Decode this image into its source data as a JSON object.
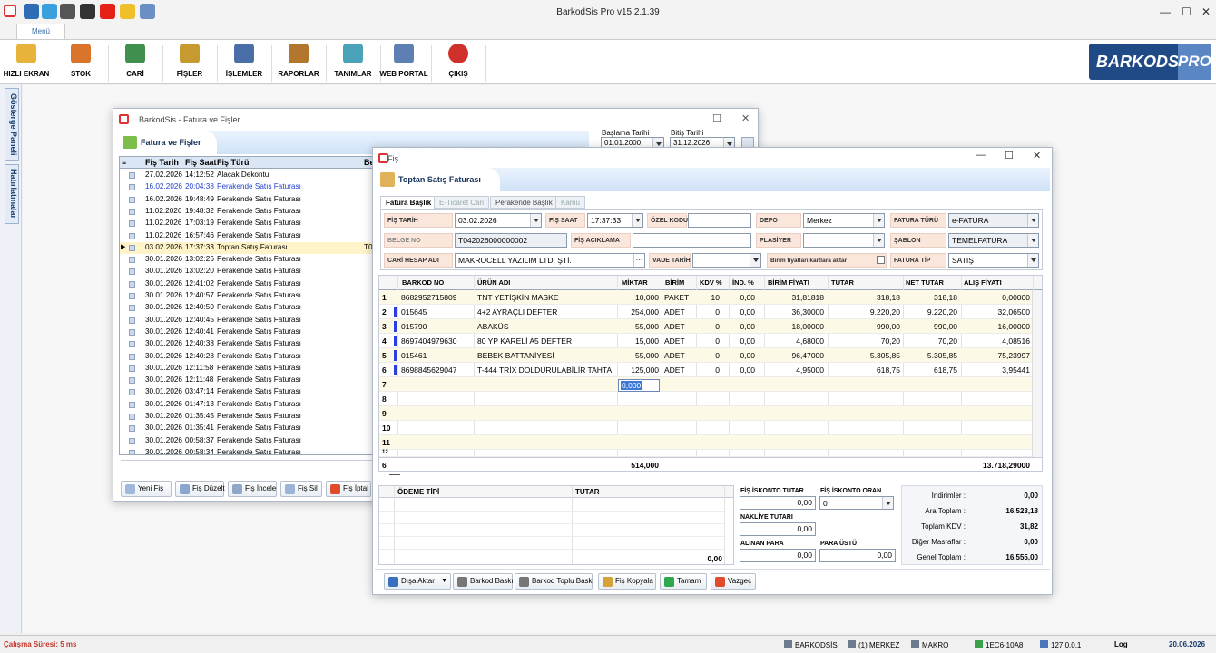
{
  "app": {
    "title": "BarkodSis Pro v15.2.1.39"
  },
  "ribbon": {
    "menu_tab": "Menü",
    "buttons": [
      {
        "label": "HIZLI EKRAN",
        "color": "#e8b33a"
      },
      {
        "label": "STOK",
        "color": "#d9742a"
      },
      {
        "label": "CARİ",
        "color": "#3f8f4f"
      },
      {
        "label": "FİŞLER",
        "color": "#c79a30"
      },
      {
        "label": "İŞLEMLER",
        "color": "#4a6ea8"
      },
      {
        "label": "RAPORLAR",
        "color": "#b2762f"
      },
      {
        "label": "TANIMLAR",
        "color": "#4aa3b8"
      },
      {
        "label": "WEB PORTAL",
        "color": "#5d7fb3"
      },
      {
        "label": "ÇIKIŞ",
        "color": "#d0302a"
      }
    ],
    "logo": "BARKODSİS",
    "logo_pro": "PRO"
  },
  "side": {
    "tab1": "Gösterge Paneli",
    "tab2": "Hatırlatmalar"
  },
  "listwin": {
    "title": "BarkodSis - Fatura ve Fişler",
    "header": "Fatura ve Fişler",
    "start_label": "Başlama Tarihi",
    "start_value": "01.01.2000",
    "end_label": "Bitiş Tarihi",
    "end_value": "31.12.2026",
    "columns": [
      "Fiş Tarih",
      "Fiş Saat",
      "Fiş Türü",
      "Be"
    ],
    "rows": [
      {
        "date": "27.02.2026",
        "time": "14:12:52",
        "type": "Alacak Dekontu",
        "style": "normal"
      },
      {
        "date": "16.02.2026",
        "time": "20:04:38",
        "type": "Perakende Satış Faturası",
        "style": "blue"
      },
      {
        "date": "16.02.2026",
        "time": "19:48:49",
        "type": "Perakende Satış Faturası",
        "style": "normal"
      },
      {
        "date": "11.02.2026",
        "time": "19:48:32",
        "type": "Perakende Satış Faturası",
        "style": "normal"
      },
      {
        "date": "11.02.2026",
        "time": "17:03:19",
        "type": "Perakende Satış Faturası",
        "style": "normal"
      },
      {
        "date": "11.02.2026",
        "time": "16:57:46",
        "type": "Perakende Satış Faturası",
        "style": "normal"
      },
      {
        "date": "03.02.2026",
        "time": "17:37:33",
        "type": "Toptan Satış Faturası",
        "style": "selected",
        "extra": "T04"
      },
      {
        "date": "30.01.2026",
        "time": "13:02:26",
        "type": "Perakende Satış Faturası",
        "style": "normal"
      },
      {
        "date": "30.01.2026",
        "time": "13:02:20",
        "type": "Perakende Satış Faturası",
        "style": "normal"
      },
      {
        "date": "30.01.2026",
        "time": "12:41:02",
        "type": "Perakende Satış Faturası",
        "style": "normal"
      },
      {
        "date": "30.01.2026",
        "time": "12:40:57",
        "type": "Perakende Satış Faturası",
        "style": "normal"
      },
      {
        "date": "30.01.2026",
        "time": "12:40:50",
        "type": "Perakende Satış Faturası",
        "style": "normal"
      },
      {
        "date": "30.01.2026",
        "time": "12:40:45",
        "type": "Perakende Satış Faturası",
        "style": "normal"
      },
      {
        "date": "30.01.2026",
        "time": "12:40:41",
        "type": "Perakende Satış Faturası",
        "style": "normal"
      },
      {
        "date": "30.01.2026",
        "time": "12:40:38",
        "type": "Perakende Satış Faturası",
        "style": "normal"
      },
      {
        "date": "30.01.2026",
        "time": "12:40:28",
        "type": "Perakende Satış Faturası",
        "style": "normal"
      },
      {
        "date": "30.01.2026",
        "time": "12:11:58",
        "type": "Perakende Satış Faturası",
        "style": "normal"
      },
      {
        "date": "30.01.2026",
        "time": "12:11:48",
        "type": "Perakende Satış Faturası",
        "style": "normal"
      },
      {
        "date": "30.01.2026",
        "time": "03:47:14",
        "type": "Perakende Satış Faturası",
        "style": "normal"
      },
      {
        "date": "30.01.2026",
        "time": "01:47:13",
        "type": "Perakende Satış Faturası",
        "style": "normal"
      },
      {
        "date": "30.01.2026",
        "time": "01:35:45",
        "type": "Perakende Satış Faturası",
        "style": "normal"
      },
      {
        "date": "30.01.2026",
        "time": "01:35:41",
        "type": "Perakende Satış Faturası",
        "style": "normal"
      },
      {
        "date": "30.01.2026",
        "time": "00:58:37",
        "type": "Perakende Satış Faturası",
        "style": "normal"
      },
      {
        "date": "30.01.2026",
        "time": "00:58:34",
        "type": "Perakende Satış Faturası",
        "style": "normal"
      }
    ],
    "buttons": [
      "Yeni Fiş",
      "Fiş Düzelt",
      "Fiş İncele",
      "Fiş Sil",
      "Fiş İptal"
    ]
  },
  "fis": {
    "title": "Fiş",
    "header": "Toptan Satış Faturası",
    "tabs": [
      "Fatura Başlık",
      "E-Ticaret Cari",
      "Perakende Başlık",
      "Kamu"
    ],
    "fields": {
      "fis_tarih_label": "FİŞ TARİH",
      "fis_tarih": "03.02.2026",
      "fis_saat_label": "FİŞ SAAT",
      "fis_saat": "17:37:33",
      "ozel_kodu_label": "ÖZEL KODU",
      "ozel_kodu": "",
      "depo_label": "DEPO",
      "depo": "Merkez",
      "fatura_turu_label": "FATURA TÜRÜ",
      "fatura_turu": "e-FATURA",
      "belge_no_label": "BELGE NO",
      "belge_no": "T042026000000002",
      "fis_aciklama_label": "FİŞ AÇIKLAMA",
      "fis_aciklama": "",
      "plasiyer_label": "PLASİYER",
      "plasiyer": "",
      "sablon_label": "ŞABLON",
      "sablon": "TEMELFATURA",
      "cari_hesap_label": "CARİ HESAP ADI",
      "cari_hesap": "MAKROCELL YAZILIM LTD. ŞTİ.",
      "vade_tarih_label": "VADE TARİH",
      "vade_tarih": "",
      "birim_fiyat_label": "Birim fiyatları kartlara aktar",
      "fatura_tip_label": "FATURA TİP",
      "fatura_tip": "SATIŞ"
    },
    "columns": [
      "BARKOD NO",
      "ÜRÜN ADI",
      "MİKTAR",
      "BİRİM",
      "KDV %",
      "İND. %",
      "BİRİM FİYATI",
      "TUTAR",
      "NET TUTAR",
      "ALIŞ FİYATI"
    ],
    "items": [
      {
        "no": "1",
        "barkod": "8682952715809",
        "urun": "TNT YETİŞKİN MASKE",
        "miktar": "10,000",
        "birim": "PAKET",
        "kdv": "10",
        "ind": "0,00",
        "fiyat": "31,81818",
        "tutar": "318,18",
        "net": "318,18",
        "alis": "0,00000"
      },
      {
        "no": "2",
        "barkod": "015645",
        "urun": "4+2 AYRAÇLI DEFTER",
        "miktar": "254,000",
        "birim": "ADET",
        "kdv": "0",
        "ind": "0,00",
        "fiyat": "36,30000",
        "tutar": "9.220,20",
        "net": "9.220,20",
        "alis": "32,06500"
      },
      {
        "no": "3",
        "barkod": "015790",
        "urun": "ABAKÜS",
        "miktar": "55,000",
        "birim": "ADET",
        "kdv": "0",
        "ind": "0,00",
        "fiyat": "18,00000",
        "tutar": "990,00",
        "net": "990,00",
        "alis": "16,00000"
      },
      {
        "no": "4",
        "barkod": "8697404979630",
        "urun": "80 YP KARELİ A5 DEFTER",
        "miktar": "15,000",
        "birim": "ADET",
        "kdv": "0",
        "ind": "0,00",
        "fiyat": "4,68000",
        "tutar": "70,20",
        "net": "70,20",
        "alis": "4,08516"
      },
      {
        "no": "5",
        "barkod": "015461",
        "urun": "BEBEK BATTANİYESİ",
        "miktar": "55,000",
        "birim": "ADET",
        "kdv": "0",
        "ind": "0,00",
        "fiyat": "96,47000",
        "tutar": "5.305,85",
        "net": "5.305,85",
        "alis": "75,23997"
      },
      {
        "no": "6",
        "barkod": "8698845629047",
        "urun": "T-444 TRİX DOLDURULABİLİR TAHTA",
        "miktar": "125,000",
        "birim": "ADET",
        "kdv": "0",
        "ind": "0,00",
        "fiyat": "4,95000",
        "tutar": "618,75",
        "net": "618,75",
        "alis": "3,95441"
      }
    ],
    "empty_rows": [
      "7",
      "8",
      "9",
      "10",
      "11",
      "12"
    ],
    "edit_value": "0,000",
    "footer": {
      "count": "6",
      "miktar": "514,000",
      "alis": "13.718,29000"
    },
    "odeme": {
      "col1": "ÖDEME TİPİ",
      "col2": "TUTAR",
      "total": "0,00"
    },
    "fis_iskonto_tutar_label": "FİŞ İSKONTO TUTAR",
    "fis_iskonto_tutar": "0,00",
    "fis_iskonto_oran_label": "FİŞ İSKONTO ORAN",
    "fis_iskonto_oran": "0",
    "nakliye_label": "NAKLİYE TUTARI",
    "nakliye": "0,00",
    "alinan_label": "ALINAN PARA",
    "alinan": "0,00",
    "para_ustu_label": "PARA ÜSTÜ",
    "para_ustu": "0,00",
    "totals": [
      {
        "label": "İndirimler :",
        "value": "0,00"
      },
      {
        "label": "Ara Toplam :",
        "value": "16.523,18"
      },
      {
        "label": "Toplam KDV :",
        "value": "31,82"
      },
      {
        "label": "Diğer Masraflar :",
        "value": "0,00"
      },
      {
        "label": "Genel Toplam :",
        "value": "16.555,00"
      }
    ],
    "buttons": [
      "Dışa Aktar",
      "Barkod Baskı",
      "Barkod Toplu Baskı",
      "Fiş Kopyala",
      "Tamam",
      "Vazgeç"
    ]
  },
  "status": {
    "calisma": "Çalışma Süresi: 5 ms",
    "user": "BARKODSİS",
    "depo": "(1) MERKEZ",
    "firma": "MAKRO",
    "code": "1EC6-10A8",
    "ip": "127.0.0.1",
    "log": "Log",
    "date": "20.06.2026"
  }
}
